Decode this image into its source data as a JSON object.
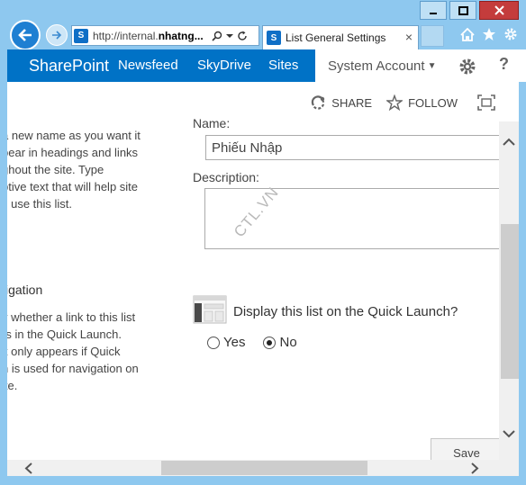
{
  "browser": {
    "address_prefix": "http://internal.",
    "address_host": "nhatng...",
    "tab_title": "List General Settings",
    "tab_close": "×",
    "colors": {
      "frame": "#8ec8ef",
      "back_button": "#1e7fd2"
    }
  },
  "suite_bar": {
    "brand": "SharePoint",
    "links": [
      "Newsfeed",
      "SkyDrive",
      "Sites"
    ],
    "user": "System Account",
    "color": "#0072c6"
  },
  "actions": {
    "share": "SHARE",
    "follow": "FOLLOW"
  },
  "left_column": {
    "name_description": "a new name as you want it\npear in headings and links\nghout the site. Type\nptive text that will help site\ns use this list.",
    "navigation_heading": "igation",
    "navigation_description": "y whether a link to this list\nrs in the Quick Launch.\nit only appears if Quick\nh is used for navigation on\nite."
  },
  "form": {
    "name_label": "Name:",
    "name_value": "Phiếu Nhập",
    "description_label": "Description:",
    "description_value": "",
    "quick_launch_question": "Display this list on the Quick Launch?",
    "radio_yes": "Yes",
    "radio_no": "No",
    "selected": "No",
    "save_label": "Save"
  },
  "watermark": "CTL.VN"
}
